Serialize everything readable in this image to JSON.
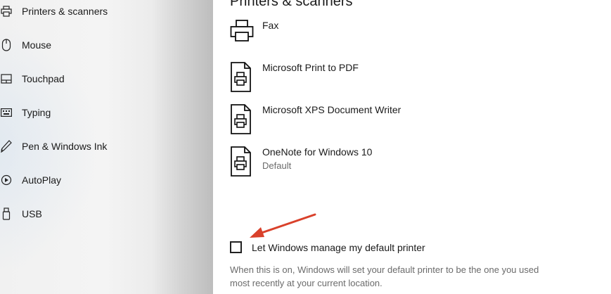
{
  "sidebar": {
    "items": [
      {
        "label": "Printers & scanners",
        "icon": "printer-icon"
      },
      {
        "label": "Mouse",
        "icon": "mouse-icon"
      },
      {
        "label": "Touchpad",
        "icon": "touchpad-icon"
      },
      {
        "label": "Typing",
        "icon": "keyboard-icon"
      },
      {
        "label": "Pen & Windows Ink",
        "icon": "pen-icon"
      },
      {
        "label": "AutoPlay",
        "icon": "autoplay-icon"
      },
      {
        "label": "USB",
        "icon": "usb-icon"
      }
    ]
  },
  "main": {
    "title": "Printers & scanners",
    "printers": [
      {
        "name": "Fax",
        "icon": "fax-icon"
      },
      {
        "name": "Microsoft Print to PDF",
        "icon": "printer-document-icon"
      },
      {
        "name": "Microsoft XPS Document Writer",
        "icon": "printer-document-icon"
      },
      {
        "name": "OneNote for Windows 10",
        "status": "Default",
        "icon": "printer-document-icon"
      }
    ],
    "default_printer": {
      "label": "Let Windows manage my default printer",
      "checked": false,
      "description": "When this is on, Windows will set your default printer to be the one you used most recently at your current location."
    }
  },
  "annotation": {
    "type": "arrow",
    "color": "#d9412b"
  }
}
